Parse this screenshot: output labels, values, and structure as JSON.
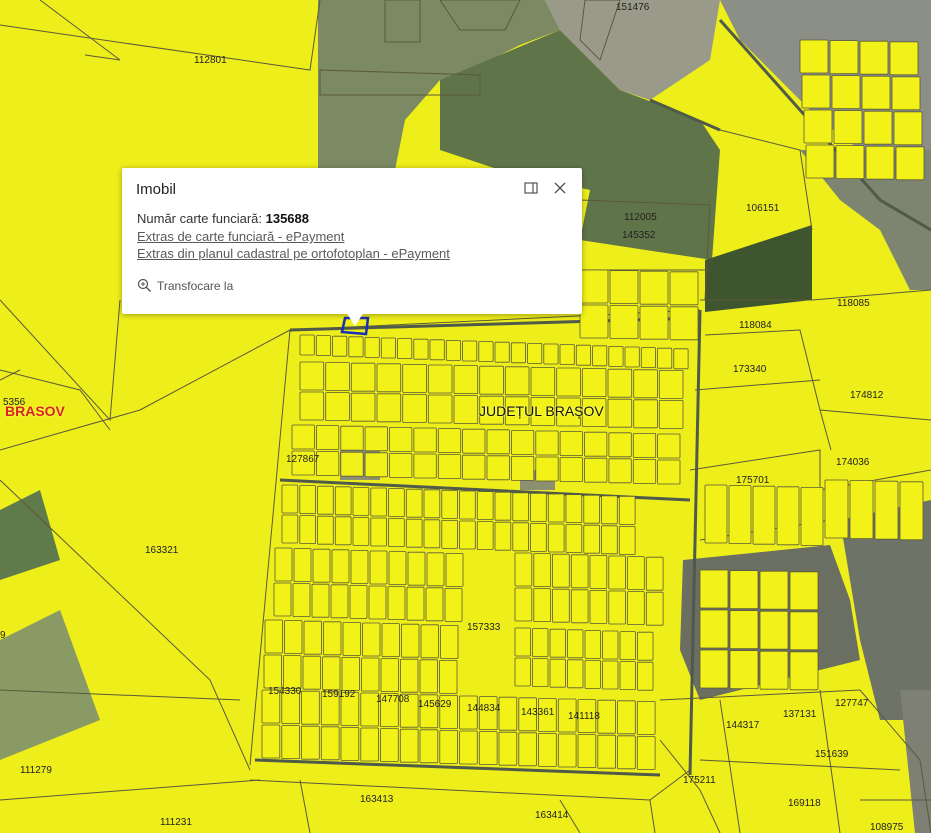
{
  "popup": {
    "title": "Imobil",
    "cf_label": "Număr carte funciară: ",
    "cf_number": "135688",
    "link_extras_cf": "Extras de carte funciară - ePayment",
    "link_extras_plan": "Extras din planul cadastral pe ortofotoplan - ePayment",
    "zoom_label": "Transfocare la"
  },
  "map": {
    "region_label": "JUDEȚUL BRAȘOV",
    "city_label": "BRASOV",
    "partial_labels": [
      "5356",
      "9"
    ],
    "parcels": [
      "151476",
      "112801",
      "112005",
      "145352",
      "106151",
      "118085",
      "118084",
      "173340",
      "174812",
      "174036",
      "175701",
      "127867",
      "163321",
      "157333",
      "154330",
      "159192",
      "147708",
      "145629",
      "144834",
      "143361",
      "141118",
      "144317",
      "137131",
      "127747",
      "151639",
      "111279",
      "175211",
      "163413",
      "169118",
      "111231",
      "163414",
      "108975"
    ]
  },
  "colors": {
    "parcel_fill": "#f2f218",
    "parcel_stroke": "#5a5a3a",
    "highlight": "#1a2fb5",
    "field_dark": "#6f7d58",
    "city_label": "#d6231f"
  }
}
